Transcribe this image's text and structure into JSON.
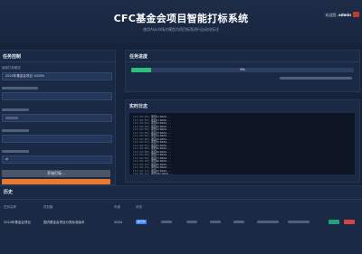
{
  "header": {
    "title": "CFC基金会项目智能打标系统",
    "subtitle": "使用AI从市场大模型为项目标签进行自动化标注",
    "welcome_prefix": "欢迎您,",
    "welcome_user": "admin"
  },
  "control_panel": {
    "title": "任务控制",
    "fields": [
      {
        "label": "选择打标模式",
        "value": ""
      },
      {
        "label": "",
        "value": "2024年基金会项目 1000%"
      },
      {
        "label": "",
        "value": ""
      },
      {
        "label": "",
        "value": ""
      },
      {
        "label": "",
        "value": "al"
      }
    ],
    "start_label": "开始打标..."
  },
  "progress_panel": {
    "title": "任务进度",
    "progress": 0.09,
    "progress_text": "9%"
  },
  "log_panel": {
    "title": "实时日志",
    "lines": [
      {
        "ts": "[11:22:03]",
        "msg": "项目1/1024..."
      },
      {
        "ts": "[11:22:03]",
        "msg": "项目1/1024..."
      },
      {
        "ts": "[11:22:04]",
        "msg": "项目2/1024..."
      },
      {
        "ts": "[11:22:04]",
        "msg": "项目2/1024..."
      },
      {
        "ts": "[11:22:05]",
        "msg": "项目3/1024..."
      },
      {
        "ts": "[11:22:05]",
        "msg": "项目3/1024..."
      },
      {
        "ts": "[11:22:06]",
        "msg": "项目4/1024..."
      },
      {
        "ts": "[11:22:06]",
        "msg": "项目4/1024..."
      },
      {
        "ts": "[11:22:07]",
        "msg": "项目5/1024..."
      },
      {
        "ts": "[11:22:07]",
        "msg": "项目5/1024..."
      },
      {
        "ts": "[11:22:08]",
        "msg": "项目6/1024..."
      },
      {
        "ts": "[11:22:08]",
        "msg": "项目6/1024..."
      },
      {
        "ts": "[11:22:09]",
        "msg": "项目7/1024..."
      },
      {
        "ts": "[11:22:09]",
        "msg": "项目7/1024..."
      },
      {
        "ts": "[11:22:10]",
        "msg": "项目8/1024..."
      },
      {
        "ts": "[11:22:10]",
        "msg": "项目8/1024..."
      },
      {
        "ts": "[11:22:11]",
        "msg": "项目9/1024..."
      },
      {
        "ts": "[11:22:11]",
        "msg": "项目9/1024..."
      },
      {
        "ts": "[11:22:12]",
        "msg": "项目10/1024..."
      }
    ]
  },
  "history": {
    "title": "历史",
    "headers": [
      "任务名称",
      "项目集",
      "年度",
      "状态",
      "",
      "",
      "",
      "",
      "",
      "",
      ""
    ],
    "row": {
      "name": "2024年基金会项目",
      "dataset": "国内基金会项目分类标准版本",
      "year": "2024",
      "status": "进行中"
    }
  },
  "colors": {
    "accent_green": "#2ec07a",
    "stop_orange": "#e8792e",
    "badge_blue": "#3b82f6",
    "danger_red": "#d64545"
  }
}
